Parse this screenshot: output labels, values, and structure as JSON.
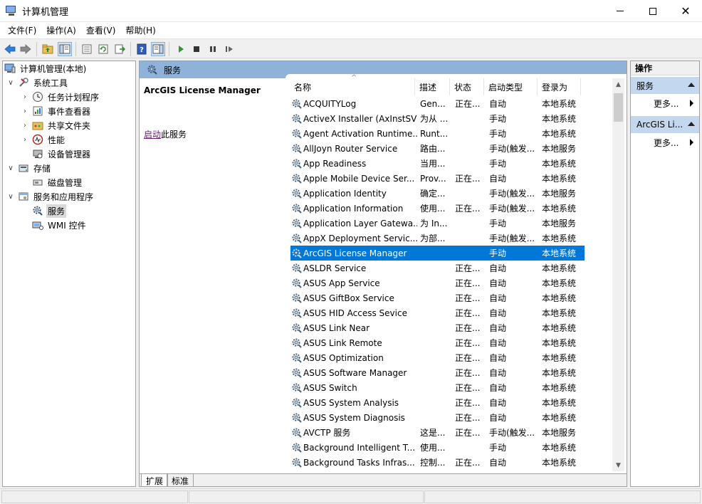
{
  "window": {
    "title": "计算机管理",
    "controls": {
      "minimize_icon": "minimize-icon",
      "maximize_icon": "maximize-icon",
      "close_glyph": "✕"
    }
  },
  "menu": [
    "文件(F)",
    "操作(A)",
    "查看(V)",
    "帮助(H)"
  ],
  "toolbar": {
    "icons": [
      "back-arrow-icon",
      "forward-arrow-icon",
      "up-folder-icon",
      "show-hide-tree-icon",
      "properties-icon",
      "refresh-icon",
      "export-list-icon",
      "help-icon",
      "show-action-pane-icon",
      "start-service-icon",
      "stop-service-icon",
      "pause-service-icon",
      "resume-service-icon"
    ]
  },
  "tree": [
    {
      "label": "计算机管理(本地)",
      "icon": "computer-management-icon",
      "expander": "",
      "selected": false
    },
    {
      "label": "系统工具",
      "icon": "system-tools-icon",
      "expander": "∨",
      "selected": false
    },
    {
      "label": "任务计划程序",
      "icon": "task-scheduler-icon",
      "expander": "›",
      "selected": false
    },
    {
      "label": "事件查看器",
      "icon": "event-viewer-icon",
      "expander": "›",
      "selected": false
    },
    {
      "label": "共享文件夹",
      "icon": "shared-folders-icon",
      "expander": "›",
      "selected": false
    },
    {
      "label": "性能",
      "icon": "performance-icon",
      "expander": "›",
      "selected": false
    },
    {
      "label": "设备管理器",
      "icon": "device-manager-icon",
      "expander": "",
      "selected": false
    },
    {
      "label": "存储",
      "icon": "storage-icon",
      "expander": "∨",
      "selected": false
    },
    {
      "label": "磁盘管理",
      "icon": "disk-management-icon",
      "expander": "",
      "selected": false
    },
    {
      "label": "服务和应用程序",
      "icon": "services-applications-icon",
      "expander": "∨",
      "selected": false
    },
    {
      "label": "服务",
      "icon": "services-icon",
      "expander": "",
      "selected": true
    },
    {
      "label": "WMI 控件",
      "icon": "wmi-control-icon",
      "expander": "",
      "selected": false
    }
  ],
  "center": {
    "header_title": "服务",
    "selected_service_name": "ArcGIS License Manager",
    "start_link": "启动",
    "start_suffix": "此服务",
    "columns": [
      "名称",
      "描述",
      "状态",
      "启动类型",
      "登录为"
    ],
    "sort_indicator": "^",
    "tabs": [
      "扩展",
      "标准"
    ]
  },
  "services": [
    {
      "name": "ACQUITYLog",
      "desc": "Gen...",
      "status": "正在...",
      "startup": "自动",
      "logon": "本地系统",
      "selected": false
    },
    {
      "name": "ActiveX Installer (AxInstSV)",
      "desc": "为从 ...",
      "status": "",
      "startup": "手动",
      "logon": "本地系统",
      "selected": false
    },
    {
      "name": "Agent Activation Runtime...",
      "desc": "Runt...",
      "status": "",
      "startup": "手动",
      "logon": "本地系统",
      "selected": false
    },
    {
      "name": "AllJoyn Router Service",
      "desc": "路由...",
      "status": "",
      "startup": "手动(触发...",
      "logon": "本地服务",
      "selected": false
    },
    {
      "name": "App Readiness",
      "desc": "当用...",
      "status": "",
      "startup": "手动",
      "logon": "本地系统",
      "selected": false
    },
    {
      "name": "Apple Mobile Device Ser...",
      "desc": "Prov...",
      "status": "正在...",
      "startup": "自动",
      "logon": "本地系统",
      "selected": false
    },
    {
      "name": "Application Identity",
      "desc": "确定...",
      "status": "",
      "startup": "手动(触发...",
      "logon": "本地服务",
      "selected": false
    },
    {
      "name": "Application Information",
      "desc": "使用...",
      "status": "正在...",
      "startup": "手动(触发...",
      "logon": "本地系统",
      "selected": false
    },
    {
      "name": "Application Layer Gatewa...",
      "desc": "为 In...",
      "status": "",
      "startup": "手动",
      "logon": "本地服务",
      "selected": false
    },
    {
      "name": "AppX Deployment Servic...",
      "desc": "为部...",
      "status": "",
      "startup": "手动(触发...",
      "logon": "本地系统",
      "selected": false
    },
    {
      "name": "ArcGIS License Manager",
      "desc": "",
      "status": "",
      "startup": "手动",
      "logon": "本地系统",
      "selected": true
    },
    {
      "name": "ASLDR Service",
      "desc": "",
      "status": "正在...",
      "startup": "自动",
      "logon": "本地系统",
      "selected": false
    },
    {
      "name": "ASUS App Service",
      "desc": "",
      "status": "正在...",
      "startup": "自动",
      "logon": "本地系统",
      "selected": false
    },
    {
      "name": "ASUS GiftBox Service",
      "desc": "",
      "status": "正在...",
      "startup": "自动",
      "logon": "本地系统",
      "selected": false
    },
    {
      "name": "ASUS HID Access Sevice",
      "desc": "",
      "status": "正在...",
      "startup": "自动",
      "logon": "本地系统",
      "selected": false
    },
    {
      "name": "ASUS Link Near",
      "desc": "",
      "status": "正在...",
      "startup": "自动",
      "logon": "本地系统",
      "selected": false
    },
    {
      "name": "ASUS Link Remote",
      "desc": "",
      "status": "正在...",
      "startup": "自动",
      "logon": "本地系统",
      "selected": false
    },
    {
      "name": "ASUS Optimization",
      "desc": "",
      "status": "正在...",
      "startup": "自动",
      "logon": "本地系统",
      "selected": false
    },
    {
      "name": "ASUS Software Manager",
      "desc": "",
      "status": "正在...",
      "startup": "自动",
      "logon": "本地系统",
      "selected": false
    },
    {
      "name": "ASUS Switch",
      "desc": "",
      "status": "正在...",
      "startup": "自动",
      "logon": "本地系统",
      "selected": false
    },
    {
      "name": "ASUS System Analysis",
      "desc": "",
      "status": "正在...",
      "startup": "自动",
      "logon": "本地系统",
      "selected": false
    },
    {
      "name": "ASUS System Diagnosis",
      "desc": "",
      "status": "正在...",
      "startup": "自动",
      "logon": "本地系统",
      "selected": false
    },
    {
      "name": "AVCTP 服务",
      "desc": "这是...",
      "status": "正在...",
      "startup": "手动(触发...",
      "logon": "本地服务",
      "selected": false
    },
    {
      "name": "Background Intelligent T...",
      "desc": "使用...",
      "status": "",
      "startup": "手动",
      "logon": "本地系统",
      "selected": false
    },
    {
      "name": "Background Tasks Infras...",
      "desc": "控制...",
      "status": "正在...",
      "startup": "自动",
      "logon": "本地系统",
      "selected": false
    }
  ],
  "actions": {
    "header": "操作",
    "sections": [
      {
        "title": "服务",
        "more": "更多..."
      },
      {
        "title": "ArcGIS Li...",
        "more": "更多..."
      }
    ]
  },
  "colors": {
    "selection": "#0078d7",
    "pane_header": "#8fb2d9",
    "action_section": "#c3d8ee",
    "link": "#6b1b6b"
  }
}
